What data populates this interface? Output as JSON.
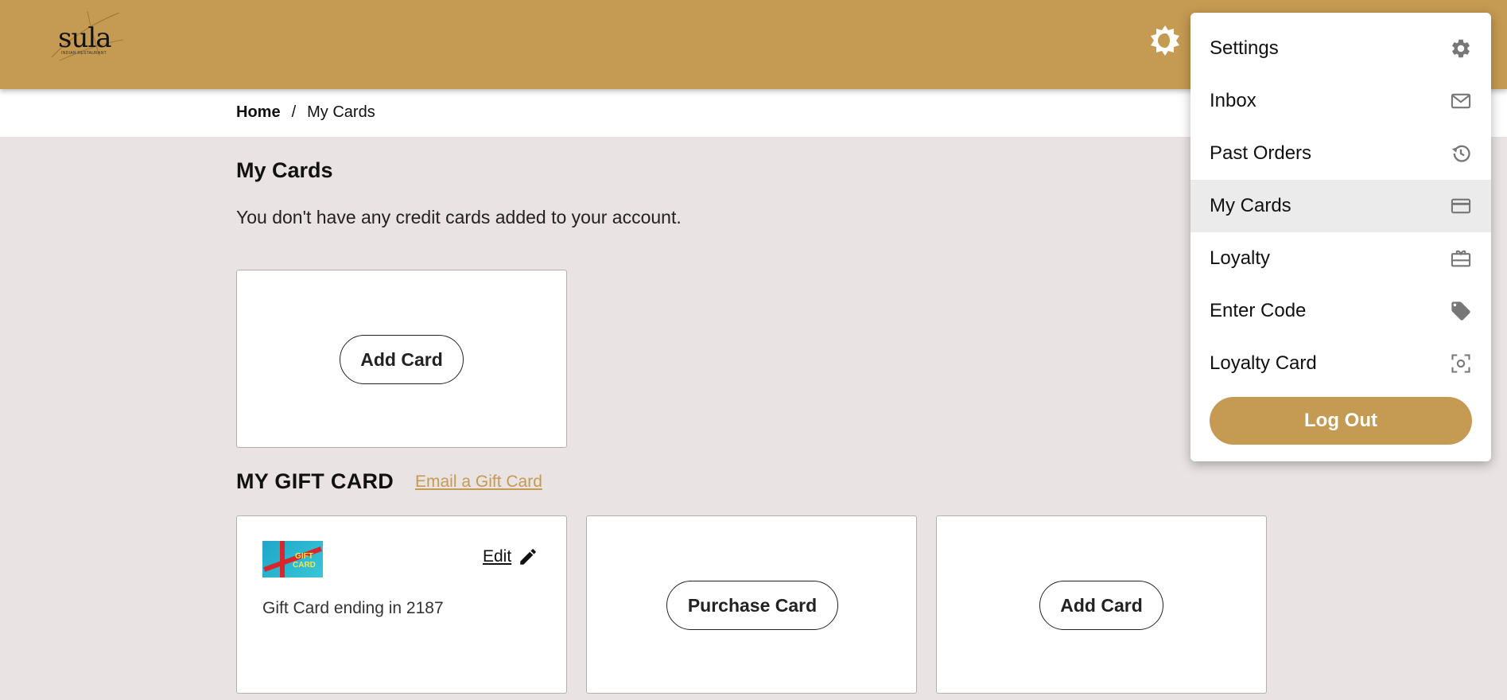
{
  "header": {
    "logo_text": "sula",
    "logo_subtext": "INDIAN RESTAURANT",
    "theme_toggle_icon": "brightness-icon",
    "brand_color": "#c59a52"
  },
  "breadcrumb": {
    "home": "Home",
    "separator": "/",
    "current": "My Cards"
  },
  "main": {
    "title": "My Cards",
    "empty_message": "You don't have any credit cards added to your account.",
    "add_card_label": "Add Card"
  },
  "gift": {
    "heading": "MY GIFT CARD",
    "email_link": "Email a Gift Card",
    "thumb_text_1": "GIFT",
    "thumb_text_2": "CARD",
    "edit_label": "Edit",
    "card_desc": "Gift Card ending in 2187",
    "purchase_label": "Purchase Card",
    "add_label": "Add Card"
  },
  "menu": {
    "items": [
      {
        "label": "Settings",
        "icon": "gear-icon"
      },
      {
        "label": "Inbox",
        "icon": "mail-icon"
      },
      {
        "label": "Past Orders",
        "icon": "history-icon"
      },
      {
        "label": "My Cards",
        "icon": "credit-card-icon",
        "active": true
      },
      {
        "label": "Loyalty",
        "icon": "gift-box-icon"
      },
      {
        "label": "Enter Code",
        "icon": "tag-icon"
      },
      {
        "label": "Loyalty Card",
        "icon": "scan-icon"
      }
    ],
    "logout_label": "Log Out"
  }
}
